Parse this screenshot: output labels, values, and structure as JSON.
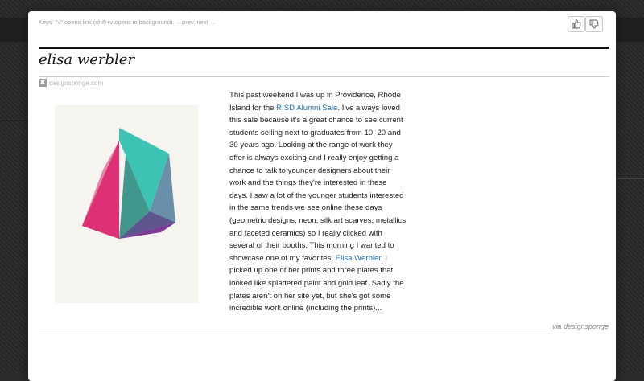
{
  "keys_hint": "Keys: \"v\" opens link (shift+v opens in background). ←prev, next →",
  "vote": {
    "up_icon": "thumbs-up-icon",
    "down_icon": "thumbs-down-icon"
  },
  "article": {
    "title": "elisa werbler",
    "source": "designsponge.com",
    "image": {
      "alt": "geometric pyramid print",
      "colors": {
        "magenta": "#e8357e",
        "teal": "#3cc3b3",
        "purple": "#7d3a96",
        "background": "#f6f4ee"
      }
    },
    "body": {
      "p1": "This past weekend I was up in Providence, Rhode Island for the ",
      "link1": "RISD Alumni Sale",
      "p2": ". I've always loved this sale because it's a great chance to see current students selling next to graduates from 10, 20 and 30 years ago. Looking at the range of work they offer is always exciting and I really enjoy getting a chance to talk to younger designers about their work and the things they're interested in these days. I saw a lot of the younger students interested in the same trends we see online these days (geometric designs, neon, silk art scarves, metallics and faceted ceramics) so I really clicked with several of their booths. This morning I wanted to showcase one of my favorites, ",
      "link2": "Elisa Werbler",
      "p3": ". I picked up one of her prints and three plates that looked like splattered paint and gold leaf. Sadly the plates aren't on her site yet, but she's got some incredible work online (including the prints)..."
    },
    "via": "via designsponge"
  },
  "colors": {
    "link": "#1e6fb8",
    "text": "#222222"
  }
}
